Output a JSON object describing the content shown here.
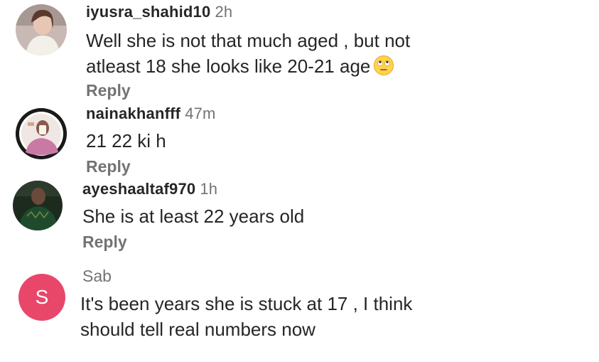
{
  "comments": [
    {
      "username": "iyusra_shahid10",
      "time": "2h",
      "line1": "Well she is not that much aged , but not",
      "line2": "atleast 18 she looks like 20-21 age",
      "emoji": "face-with-rolling-eyes-emoji",
      "reply": "Reply"
    },
    {
      "username": "nainakhanfff",
      "time": "47m",
      "line1": "21 22 ki h",
      "reply": "Reply"
    },
    {
      "username": "ayeshaaltaf970",
      "time": "1h",
      "line1": "She is at least 22 years old",
      "reply": "Reply"
    },
    {
      "username": "Sab",
      "avatar_letter": "S",
      "avatar_color": "#e8476a",
      "line1": "It's been years she is stuck at 17 , I think",
      "line2": "should tell real numbers now"
    }
  ],
  "colors": {
    "text": "#262626",
    "secondary": "#737373"
  }
}
